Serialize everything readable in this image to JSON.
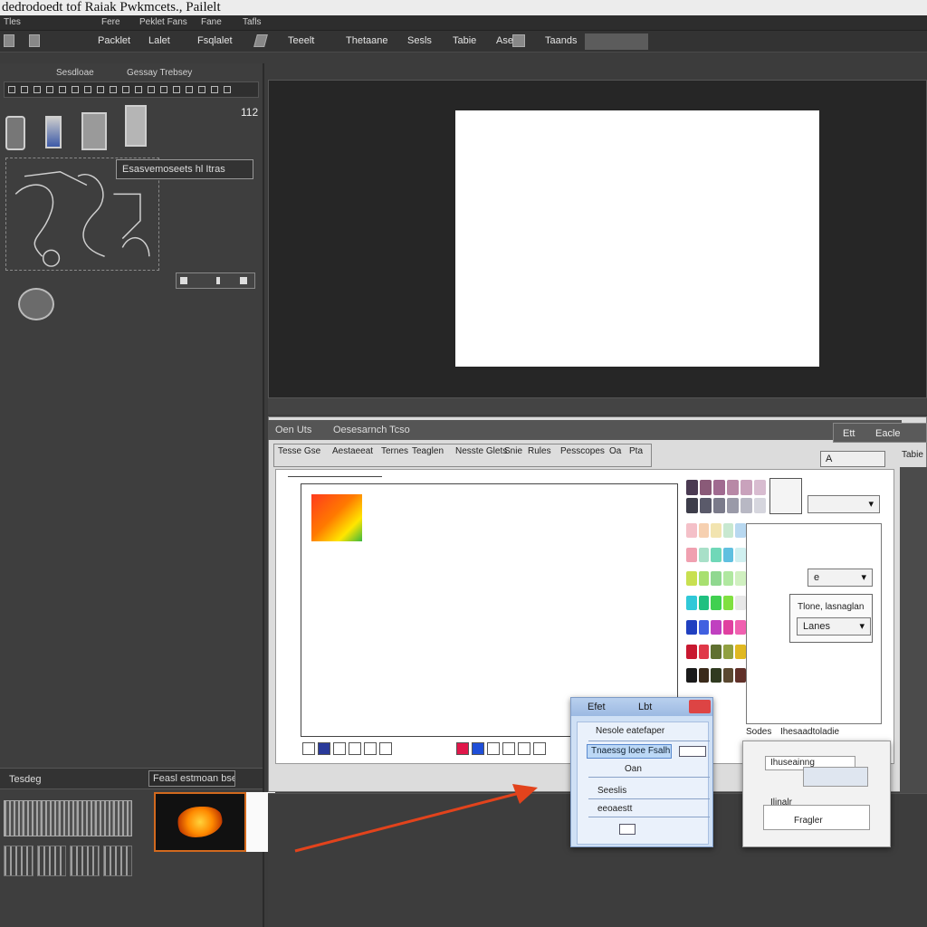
{
  "window": {
    "title": "dedrodoedt tof Raiak Pwkmcets., Pailelt"
  },
  "menu": [
    "Tles",
    "Fere",
    "Peklet Fans",
    "Fane",
    "Tafls"
  ],
  "toolbar": [
    "Packlet",
    "Lalet",
    "Fsqlalet",
    "Teeelt",
    "Thetaane",
    "Sesls",
    "Tabie",
    "Ase",
    "Taands"
  ],
  "left_panel": {
    "headers": [
      "Sesdloae",
      "Gessay Trebsey"
    ],
    "badge": "112",
    "label_box": "Esasvemoseets hl Itras",
    "lower_header": "Tesdeg",
    "lower_tab": "Feasl estmoan bsel"
  },
  "inner_window": {
    "title_left": "Oen Uts",
    "title_mid": "Oesesarnch Tcso",
    "title_right_a": "Ett",
    "title_right_b": "Eacle",
    "menu_row1": [
      "Tesse Gse",
      "Aestaeeat",
      "Ternes",
      "Teaglen",
      "Nesste Glets",
      "Snie",
      "Rules",
      "Pesscopes",
      "Oa",
      "Pta"
    ],
    "side_button": "A",
    "side_label": "Tabie",
    "dropdown_a": "",
    "dropdown_b": "e",
    "prop_a": "Tlone, lasnaglan",
    "prop_b": "Lanes",
    "bottom_tab_a": "Sodes",
    "bottom_tab_b": "Ihesaadtoladie"
  },
  "dialog1": {
    "title": "Efet",
    "title_right": "Lbt",
    "heading": "Nesole eatefaper",
    "field": "Tnaessg loee Fsalh",
    "row1": "Oan",
    "row2": "Seeslis",
    "row3": "eeoaestt"
  },
  "dialog2": {
    "label_a": "Ihuseainng",
    "label_b": "Ilinalr",
    "button": "Fragler"
  },
  "colors": {
    "accent_orange": "#d2691e",
    "arrow": "#e2431c",
    "dialog_blue": "#cfe0f5"
  }
}
